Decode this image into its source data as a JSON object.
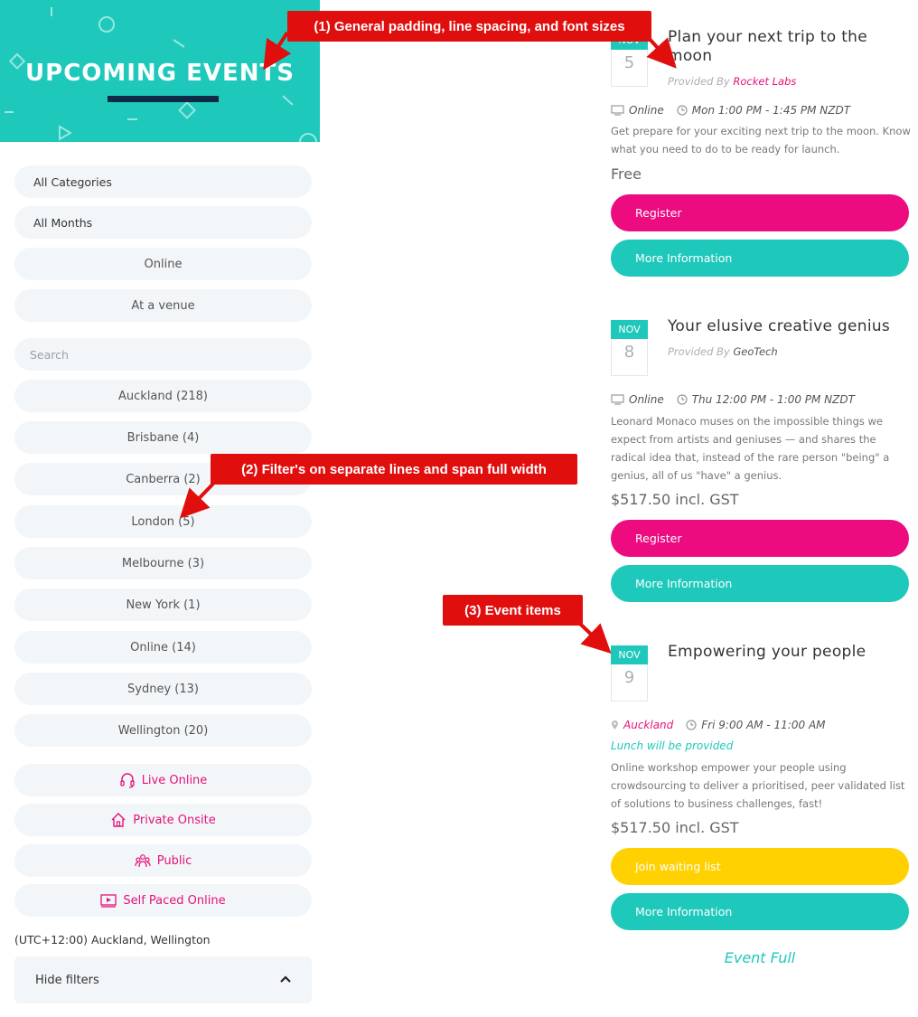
{
  "banner": {
    "title": "UPCOMING EVENTS"
  },
  "filters": {
    "categories": "All Categories",
    "months": "All Months",
    "online": "Online",
    "venue": "At a venue",
    "search_placeholder": "Search",
    "locations": [
      "Auckland (218)",
      "Brisbane (4)",
      "Canberra (2)",
      "London (5)",
      "Melbourne (3)",
      "New York (1)",
      "Online (14)",
      "Sydney (13)",
      "Wellington (20)"
    ],
    "types": [
      {
        "label": "Live Online",
        "icon": "headset-icon"
      },
      {
        "label": "Private Onsite",
        "icon": "house-icon"
      },
      {
        "label": "Public",
        "icon": "people-icon"
      },
      {
        "label": "Self Paced Online",
        "icon": "play-screen-icon"
      }
    ],
    "timezone": "(UTC+12:00) Auckland, Wellington",
    "hide_filters": "Hide filters"
  },
  "events": [
    {
      "month": "NOV",
      "day": "5",
      "title": "Plan your next trip to the moon",
      "provided_by": "Provided By",
      "provider": "Rocket Labs",
      "mode": "Online",
      "time": "Mon 1:00 PM - 1:45 PM NZDT",
      "description": "Get prepare for your exciting next trip to the moon. Know what you need to do to be ready for launch.",
      "price": "Free",
      "primary_button": "Register",
      "info_button": "More Information"
    },
    {
      "month": "NOV",
      "day": "8",
      "title": "Your elusive creative genius",
      "provided_by": "Provided By",
      "provider": "GeoTech",
      "mode": "Online",
      "time": "Thu 12:00 PM - 1:00 PM NZDT",
      "description": "Leonard Monaco muses on the impossible things we expect from artists and geniuses — and shares the radical idea that, instead of the rare person \"being\" a genius, all of us \"have\" a genius.",
      "price": "$517.50 incl. GST",
      "primary_button": "Register",
      "info_button": "More Information"
    },
    {
      "month": "NOV",
      "day": "9",
      "title": "Empowering your people",
      "location": "Auckland",
      "time": "Fri 9:00 AM - 11:00 AM",
      "note": "Lunch will be provided",
      "description": "Online workshop empower your people using crowdsourcing to deliver a prioritised, peer validated list of solutions to business challenges, fast!",
      "price": "$517.50 incl. GST",
      "primary_button": "Join waiting list",
      "info_button": "More Information",
      "status": "Event Full"
    }
  ],
  "annotations": [
    "(1) General padding, line spacing, and font sizes",
    "(2) Filter's on separate lines and span full width",
    "(3) Event items"
  ],
  "colors": {
    "teal": "#1ec8bb",
    "pink": "#ec0c80",
    "yellow": "#ffd100",
    "navy": "#0e2a47",
    "annotation": "#e10e0e"
  }
}
